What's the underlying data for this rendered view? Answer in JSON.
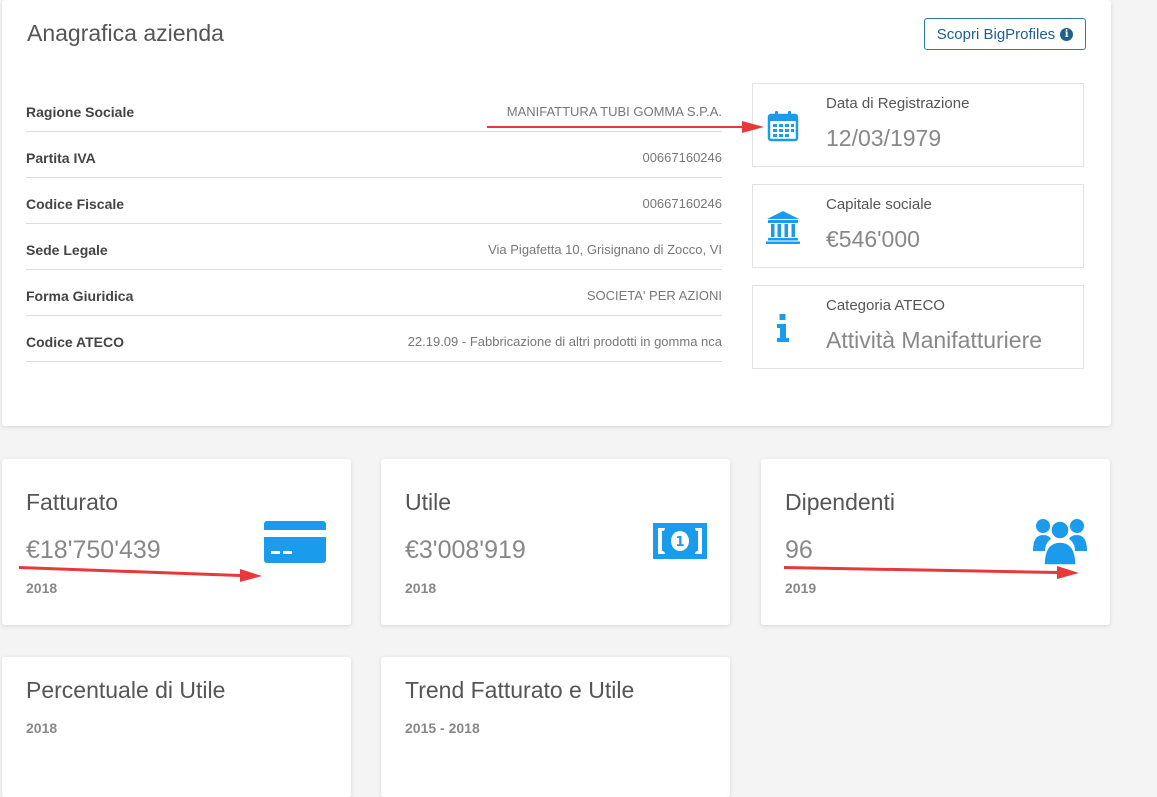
{
  "company": {
    "title": "Anagrafica azienda",
    "discover_button": "Scopri BigProfiles",
    "details": [
      {
        "label": "Ragione Sociale",
        "value": "MANIFATTURA TUBI GOMMA S.P.A."
      },
      {
        "label": "Partita IVA",
        "value": "00667160246"
      },
      {
        "label": "Codice Fiscale",
        "value": "00667160246"
      },
      {
        "label": "Sede Legale",
        "value": "Via Pigafetta 10, Grisignano di Zocco, VI"
      },
      {
        "label": "Forma Giuridica",
        "value": "SOCIETA' PER AZIONI"
      },
      {
        "label": "Codice ATECO",
        "value": "22.19.09 - Fabbricazione di altri prodotti in gomma nca"
      }
    ],
    "stats": [
      {
        "label": "Data di Registrazione",
        "value": "12/03/1979",
        "icon": "calendar-icon"
      },
      {
        "label": "Capitale sociale",
        "value": "€546'000",
        "icon": "bank-icon"
      },
      {
        "label": "Categoria ATECO",
        "value": "Attività Manifatturiere",
        "icon": "info-icon"
      }
    ]
  },
  "metrics": [
    {
      "title": "Fatturato",
      "value": "€18'750'439",
      "year": "2018",
      "icon": "credit-card-icon"
    },
    {
      "title": "Utile",
      "value": "€3'008'919",
      "year": "2018",
      "icon": "banknote-icon"
    },
    {
      "title": "Dipendenti",
      "value": "96",
      "year": "2019",
      "icon": "users-icon"
    }
  ],
  "bottom": [
    {
      "title": "Percentuale di Utile",
      "sub": "2018"
    },
    {
      "title": "Trend Fatturato e Utile",
      "sub": "2015 - 2018"
    }
  ],
  "colors": {
    "accent": "#1b9bec",
    "annotation": "#e8393a",
    "button": "#2b7ab3"
  }
}
